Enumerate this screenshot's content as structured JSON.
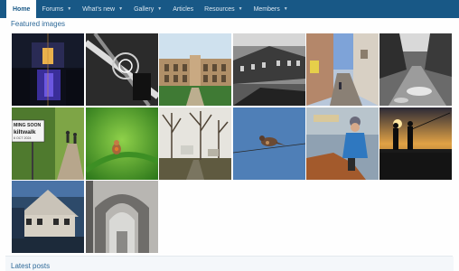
{
  "nav": {
    "items": [
      {
        "label": "Home",
        "active": true,
        "dropdown": false
      },
      {
        "label": "Forums",
        "active": false,
        "dropdown": true
      },
      {
        "label": "What's new",
        "active": false,
        "dropdown": true
      },
      {
        "label": "Gallery",
        "active": false,
        "dropdown": true
      },
      {
        "label": "Articles",
        "active": false,
        "dropdown": false
      },
      {
        "label": "Resources",
        "active": false,
        "dropdown": true
      },
      {
        "label": "Members",
        "active": false,
        "dropdown": true
      }
    ]
  },
  "featured": {
    "title": "Featured images",
    "images": [
      {
        "subject": "reflection-night-photo"
      },
      {
        "subject": "spiral-ceiling-photo"
      },
      {
        "subject": "stately-building-photo"
      },
      {
        "subject": "terraced-houses-photo"
      },
      {
        "subject": "street-scene-photo"
      },
      {
        "subject": "wet-lane-photo"
      },
      {
        "subject": "kiltwalk-sign-photo",
        "sign_text": [
          "MING SOON",
          "kiltwalk",
          "6 OCT 2024"
        ]
      },
      {
        "subject": "bird-on-green-photo"
      },
      {
        "subject": "winter-trees-photo"
      },
      {
        "subject": "bird-on-wire-photo"
      },
      {
        "subject": "rider-on-horse-photo"
      },
      {
        "subject": "fishermen-sunset-photo"
      },
      {
        "subject": "riverside-house-photo"
      },
      {
        "subject": "abbey-ruins-photo"
      }
    ]
  },
  "latest": {
    "title": "Latest posts"
  },
  "colors": {
    "navbar": "#185886",
    "title_text": "#2f6a99"
  }
}
